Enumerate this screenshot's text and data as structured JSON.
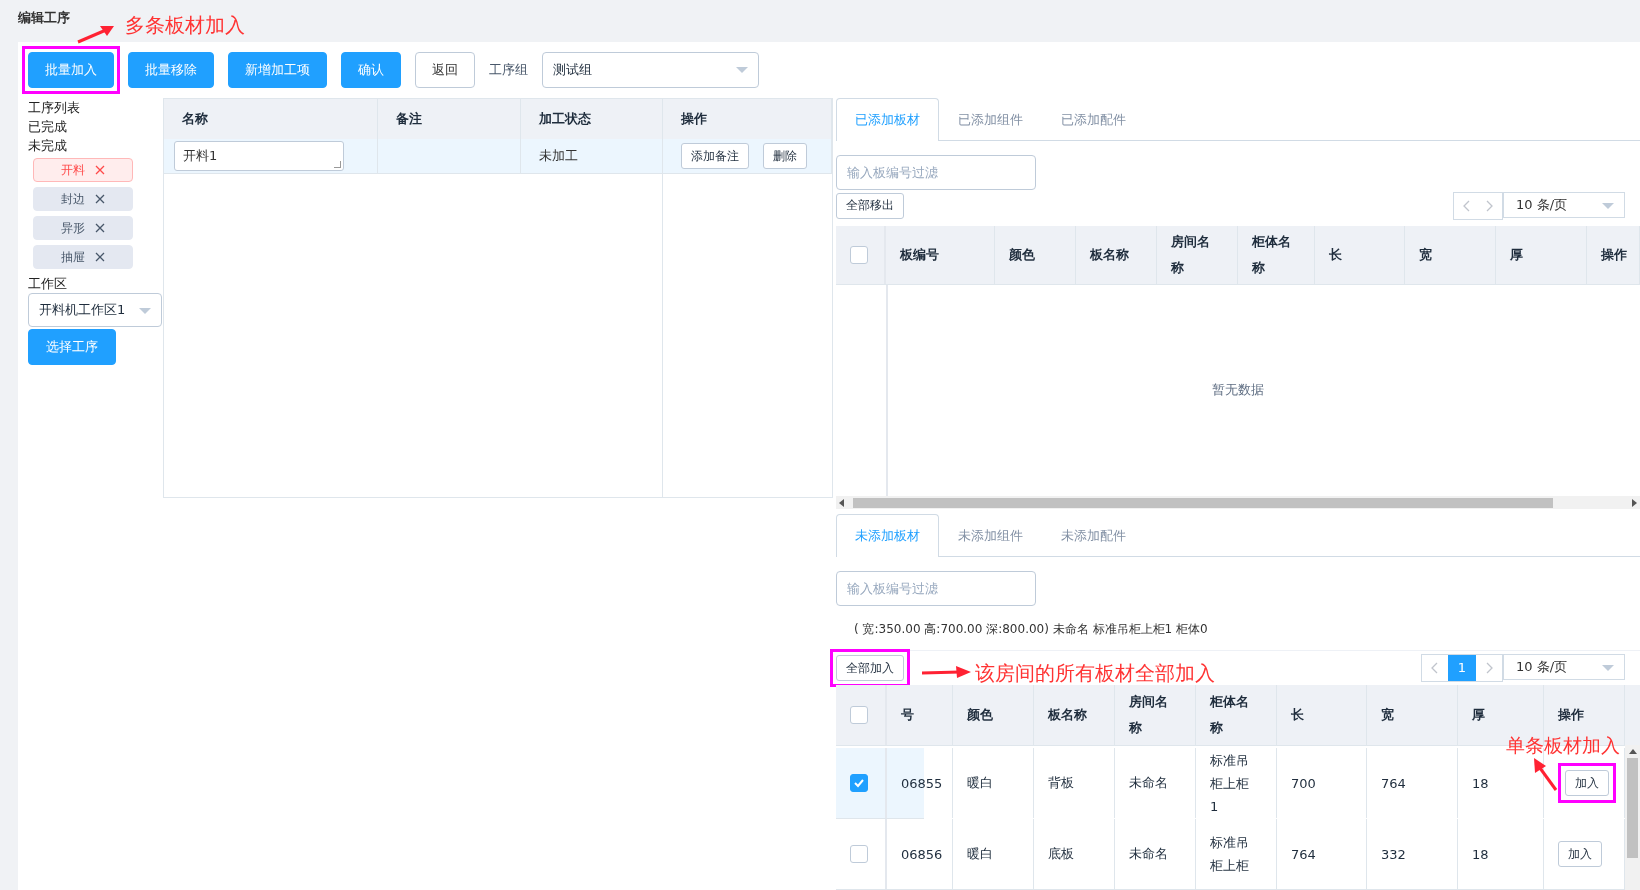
{
  "page_title": "编辑工序",
  "toolbar": {
    "buttons": [
      {
        "label": "批量加入",
        "kind": "primary",
        "highlighted": true
      },
      {
        "label": "批量移除",
        "kind": "primary",
        "highlighted": false
      },
      {
        "label": "新增加工项",
        "kind": "primary",
        "highlighted": false
      },
      {
        "label": "确认",
        "kind": "primary",
        "highlighted": false
      },
      {
        "label": "返回",
        "kind": "plain",
        "highlighted": false
      }
    ],
    "group_label": "工序组",
    "group_value": "测试组"
  },
  "sidebar": {
    "headings": [
      "工序列表",
      "已完成",
      "未完成"
    ],
    "tags": [
      {
        "label": "开料",
        "selected": true
      },
      {
        "label": "封边",
        "selected": false
      },
      {
        "label": "异形",
        "selected": false
      },
      {
        "label": "抽屉",
        "selected": false
      }
    ],
    "workarea_label": "工作区",
    "workarea_value": "开料机工作区1",
    "button": "选择工序"
  },
  "process_table": {
    "columns": [
      "名称",
      "备注",
      "加工状态",
      "操作"
    ],
    "rows": [
      {
        "name": "开料1",
        "note": "",
        "status": "未加工",
        "actions": [
          "添加备注",
          "删除"
        ]
      }
    ]
  },
  "added": {
    "tabs": [
      {
        "label": "已添加板材",
        "selected": true
      },
      {
        "label": "已添加组件",
        "selected": false
      },
      {
        "label": "已添加配件",
        "selected": false
      }
    ],
    "filter_placeholder": "输入板编号过滤",
    "button": "全部移出",
    "page_size": "10 条/页",
    "header_checked": false,
    "columns": [
      "板编号",
      "颜色",
      "板名称",
      "房间名称",
      "柜体名称",
      "长",
      "宽",
      "厚",
      "操作"
    ],
    "empty_text": "暂无数据"
  },
  "not_added": {
    "tabs": [
      {
        "label": "未添加板材",
        "selected": true
      },
      {
        "label": "未添加组件",
        "selected": false
      },
      {
        "label": "未添加配件",
        "selected": false
      }
    ],
    "filter_placeholder": "输入板编号过滤",
    "info": "( 宽:350.00 高:700.00 深:800.00) 未命名 标准吊柜上柜1 柜体0",
    "button": {
      "label": "全部加入",
      "highlighted": true
    },
    "pages": [
      {
        "label": "1",
        "selected": true
      }
    ],
    "page_size": "10 条/页",
    "header_checked": false,
    "columns": [
      "号",
      "颜色",
      "板名称",
      "房间名称",
      "柜体名称",
      "长",
      "宽",
      "厚",
      "操作"
    ],
    "rows": [
      {
        "checked": true,
        "cells": [
          "06855",
          "暖白",
          "背板",
          "未命名",
          "标准吊柜上柜1",
          "700",
          "764",
          "18"
        ],
        "action": "加入",
        "highlighted": true
      },
      {
        "checked": false,
        "cells": [
          "06856",
          "暖白",
          "底板",
          "未命名",
          "标准吊柜上柜",
          "764",
          "332",
          "18"
        ],
        "action": "加入",
        "highlighted": false
      }
    ]
  },
  "annotations": [
    "多条板材加入",
    "该房间的所有板材全部加入",
    "单条板材加入"
  ]
}
